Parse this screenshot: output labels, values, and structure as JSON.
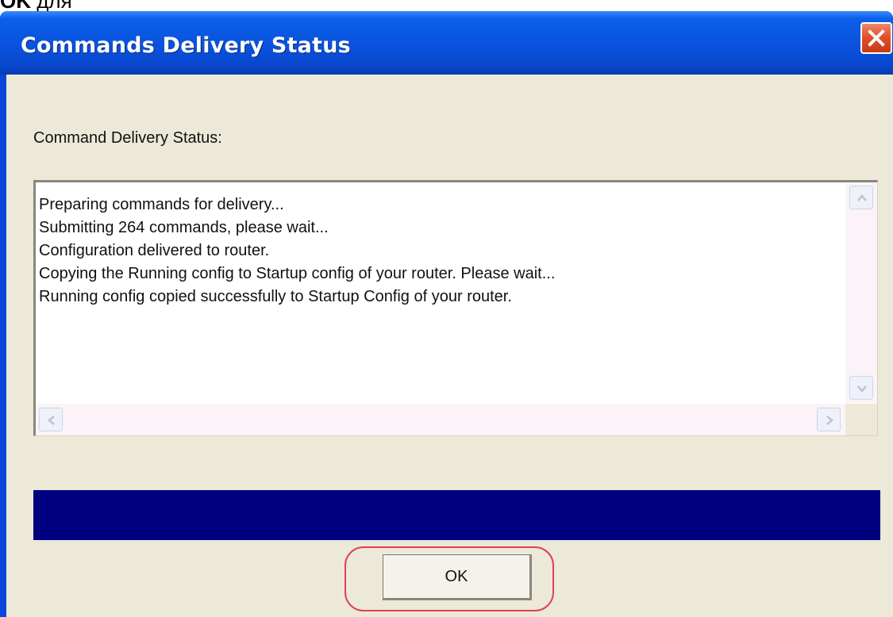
{
  "page_caption": {
    "bold": "OK",
    "rest": " для"
  },
  "window": {
    "title": "Commands Delivery Status"
  },
  "dialog": {
    "prompt_label": "Command Delivery Status:",
    "log_lines": [
      "Preparing commands for delivery...",
      "Submitting 264 commands, please wait...",
      "Configuration delivered to router.",
      "Copying the Running config to Startup config of your router. Please wait...",
      "Running config copied successfully to Startup Config of your router."
    ],
    "progress": 1.0,
    "ok_label": "OK"
  },
  "icons": {
    "close": "close-icon",
    "scroll_up": "chevron-up-icon",
    "scroll_down": "chevron-down-icon",
    "scroll_left": "chevron-left-icon",
    "scroll_right": "chevron-right-icon"
  },
  "colors": {
    "titlebar": "#0a52dd",
    "close_button": "#e0502c",
    "progress": "#000080",
    "highlight": "#e04050"
  }
}
